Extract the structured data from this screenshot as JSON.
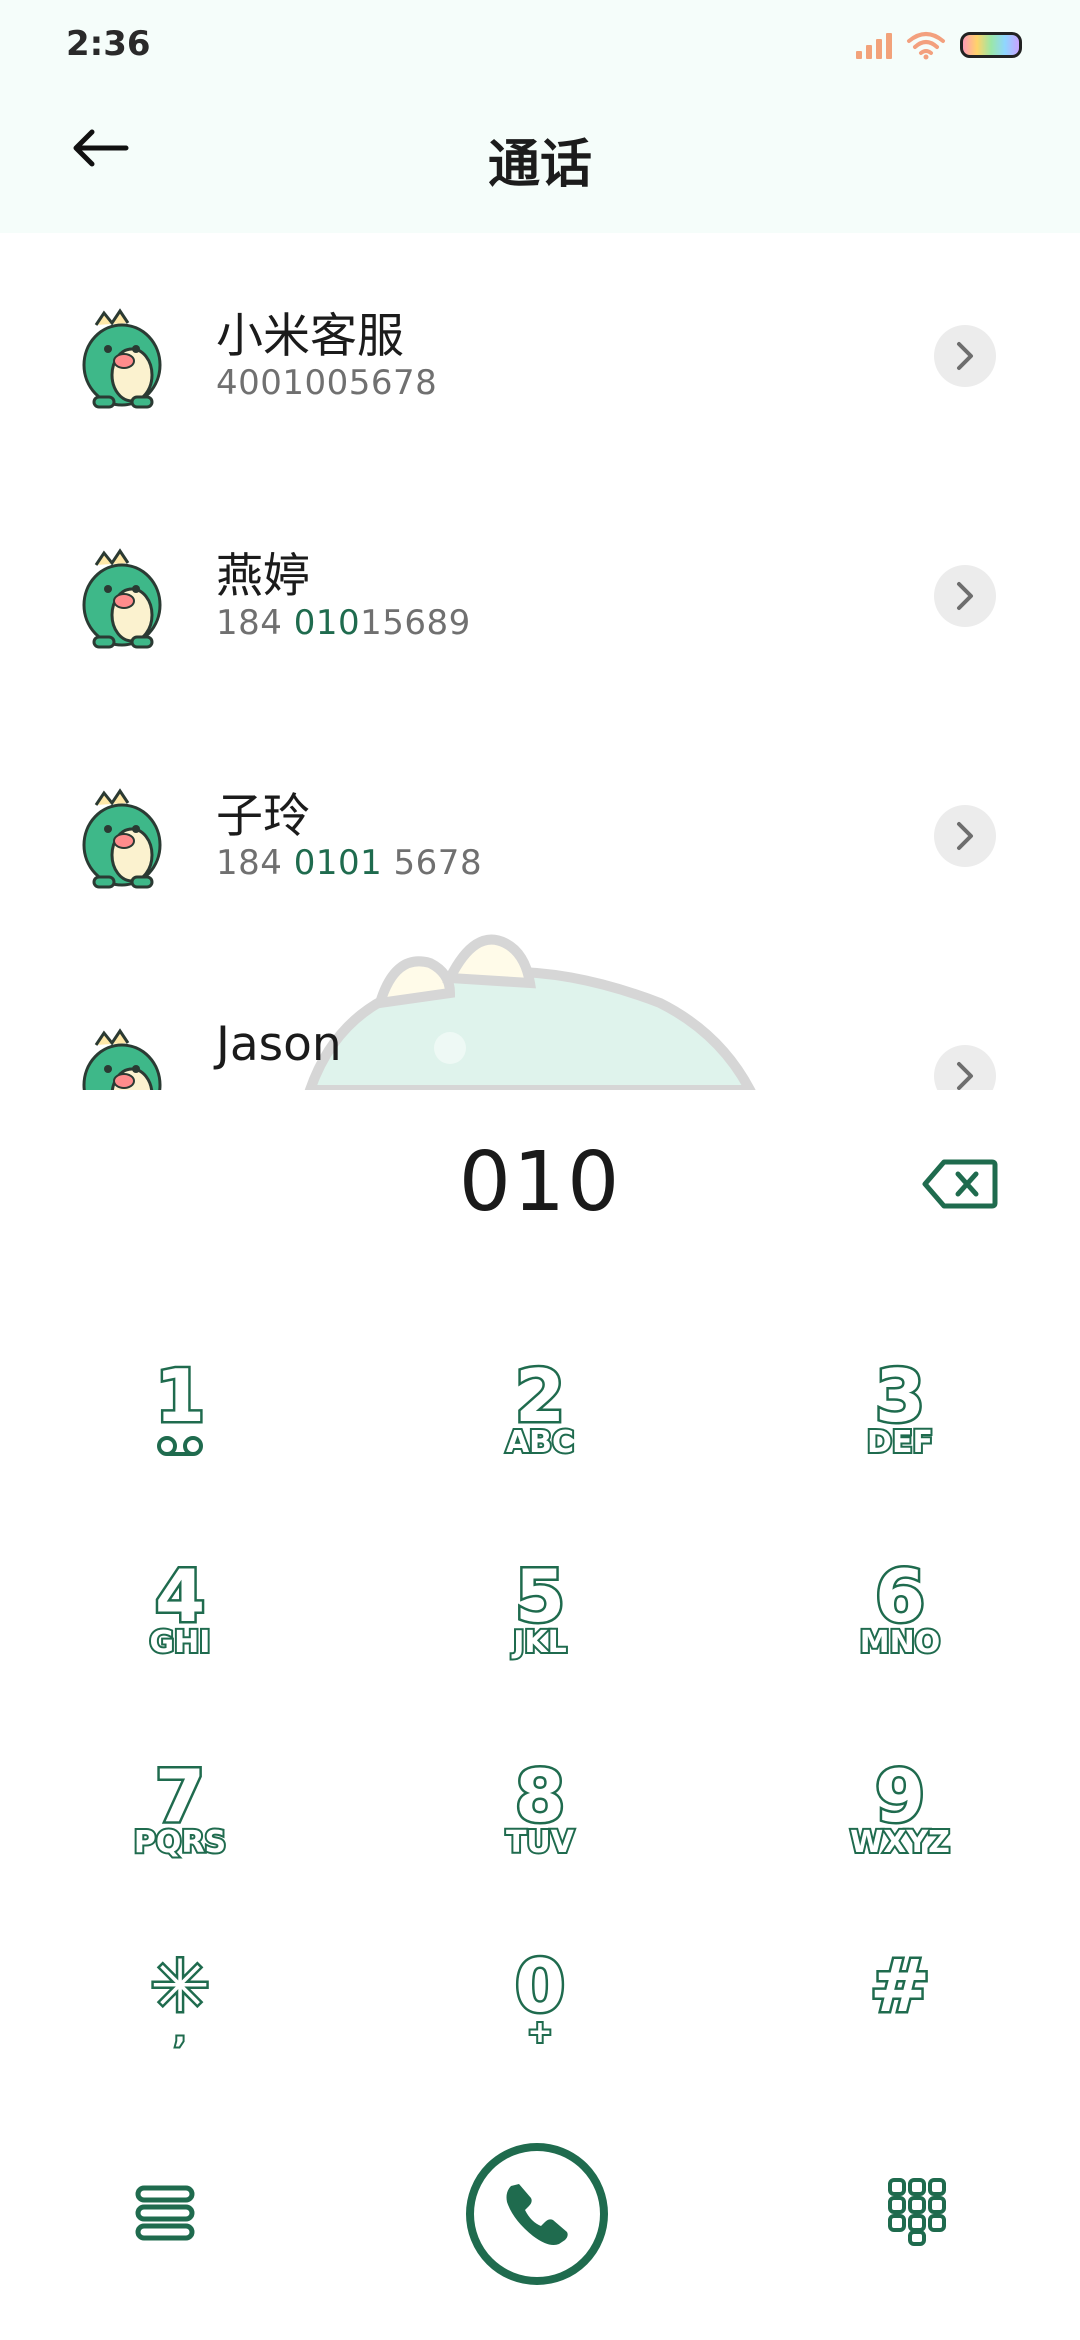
{
  "status": {
    "time": "2:36"
  },
  "header": {
    "title": "通话"
  },
  "contacts": [
    {
      "name": "小米客服",
      "number_pre": "",
      "number_hl": "",
      "number_post": "4001005678"
    },
    {
      "name": "燕婷",
      "number_pre": "184 ",
      "number_hl": "010",
      "number_post": "15689"
    },
    {
      "name": "子玲",
      "number_pre": "184 ",
      "number_hl": "0101",
      "number_post": " 5678"
    },
    {
      "name": "Jason",
      "number_pre": "",
      "number_hl": "",
      "number_post": ""
    }
  ],
  "dialer": {
    "input": "010",
    "keys": [
      {
        "digit": "1",
        "letters": ""
      },
      {
        "digit": "2",
        "letters": "ABC"
      },
      {
        "digit": "3",
        "letters": "DEF"
      },
      {
        "digit": "4",
        "letters": "GHI"
      },
      {
        "digit": "5",
        "letters": "JKL"
      },
      {
        "digit": "6",
        "letters": "MNO"
      },
      {
        "digit": "7",
        "letters": "PQRS"
      },
      {
        "digit": "8",
        "letters": "TUV"
      },
      {
        "digit": "9",
        "letters": "WXYZ"
      },
      {
        "digit": "✳",
        "letters": ","
      },
      {
        "digit": "0",
        "letters": "+"
      },
      {
        "digit": "#",
        "letters": ""
      }
    ]
  },
  "theme": {
    "accent": "#1f6b4e",
    "header_bg": "#f5fdfa"
  }
}
